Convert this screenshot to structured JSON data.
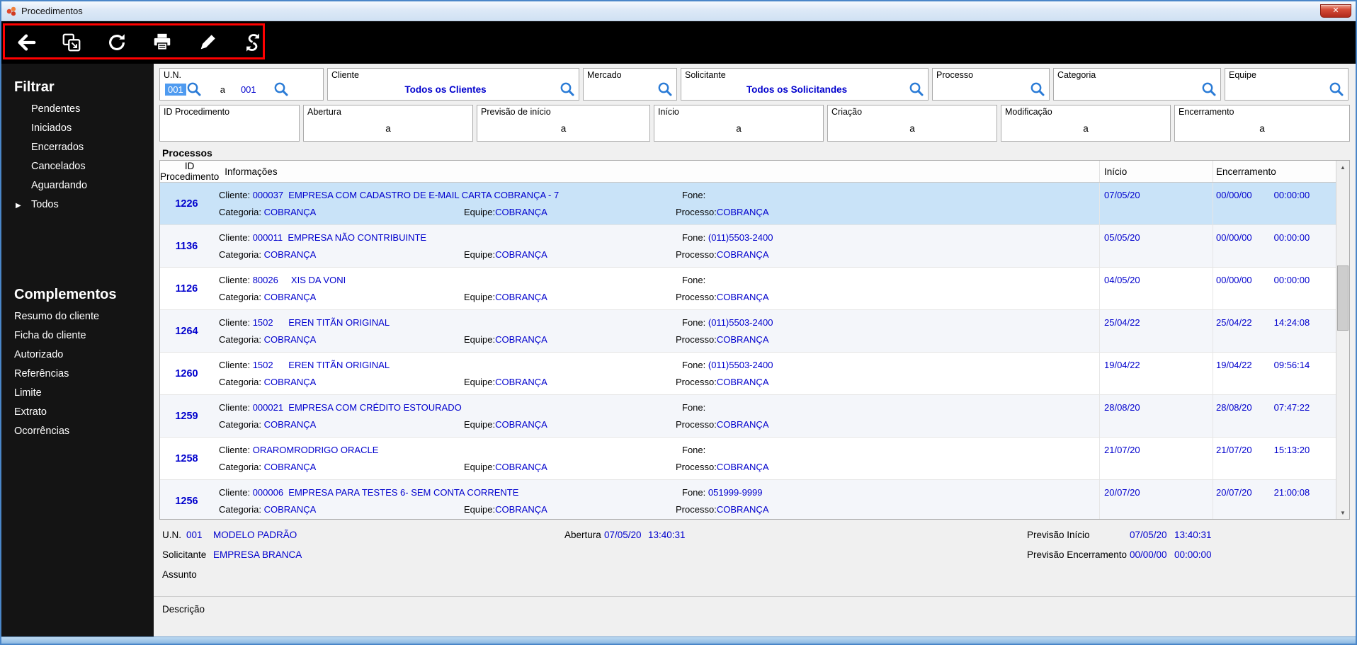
{
  "colors": {
    "accent_blue": "#0000CD",
    "selection_row": "#C9E3F8",
    "annotation_red": "#FF0000",
    "window_border": "#4A86C8",
    "toolbar_bg": "#000000",
    "sidebar_bg": "#141414"
  },
  "window": {
    "title": "Procedimentos",
    "close_glyph": "✕"
  },
  "scrollbar": {
    "up": "▲",
    "down": "▼"
  },
  "sidebar": {
    "filter_heading": "Filtrar",
    "filter_items": [
      "Pendentes",
      "Iniciados",
      "Encerrados",
      "Cancelados",
      "Aguardando",
      "Todos"
    ],
    "todos_marker": "▶",
    "complements_heading": "Complementos",
    "complement_items": [
      "Resumo do cliente",
      "Ficha do cliente",
      "Autorizado",
      "Referências",
      "Limite",
      "Extrato",
      "Ocorrências"
    ]
  },
  "filters": {
    "un_label": "U.N.",
    "un_from": "001",
    "range_sep": "a",
    "un_to": "001",
    "cliente_label": "Cliente",
    "cliente_value": "Todos os Clientes",
    "mercado_label": "Mercado",
    "solicitante_label": "Solicitante",
    "solicitante_value": "Todos os Solicitandes",
    "processo_label": "Processo",
    "categoria_label": "Categoria",
    "equipe_label": "Equipe",
    "id_proc_label": "ID Procedimento",
    "abertura_label": "Abertura",
    "previsao_inicio_label": "Previsão de início",
    "inicio_label": "Início",
    "criacao_label": "Criação",
    "modificacao_label": "Modificação",
    "encerramento_label": "Encerramento"
  },
  "table": {
    "section_label": "Processos",
    "headers": {
      "id": "ID Procedimento",
      "info": "Informações",
      "inicio": "Início",
      "encerramento": "Encerramento"
    },
    "labels": {
      "cliente": "Cliente:",
      "fone": "Fone:",
      "categoria": "Categoria:",
      "equipe": "Equipe:",
      "processo": "Processo:"
    },
    "rows": [
      {
        "id": "1226",
        "cliente": "000037  EMPRESA COM CADASTRO DE E-MAIL CARTA COBRANÇA - 7",
        "fone": "",
        "categoria": "COBRANÇA",
        "equipe": "COBRANÇA",
        "processo": "COBRANÇA",
        "inicio": "07/05/20",
        "encerramento_date": "00/00/00",
        "encerramento_time": "00:00:00",
        "selected": true
      },
      {
        "id": "1136",
        "cliente": "000011  EMPRESA NÃO CONTRIBUINTE",
        "fone": "(011)5503-2400",
        "categoria": "COBRANÇA",
        "equipe": "COBRANÇA",
        "processo": "COBRANÇA",
        "inicio": "05/05/20",
        "encerramento_date": "00/00/00",
        "encerramento_time": "00:00:00",
        "selected": false
      },
      {
        "id": "1126",
        "cliente": "80026     XIS DA VONI",
        "fone": "",
        "categoria": "COBRANÇA",
        "equipe": "COBRANÇA",
        "processo": "COBRANÇA",
        "inicio": "04/05/20",
        "encerramento_date": "00/00/00",
        "encerramento_time": "00:00:00",
        "selected": false
      },
      {
        "id": "1264",
        "cliente": "1502      EREN TITÃN ORIGINAL",
        "fone": "(011)5503-2400",
        "categoria": "COBRANÇA",
        "equipe": "COBRANÇA",
        "processo": "COBRANÇA",
        "inicio": "25/04/22",
        "encerramento_date": "25/04/22",
        "encerramento_time": "14:24:08",
        "selected": false
      },
      {
        "id": "1260",
        "cliente": "1502      EREN TITÃN ORIGINAL",
        "fone": "(011)5503-2400",
        "categoria": "COBRANÇA",
        "equipe": "COBRANÇA",
        "processo": "COBRANÇA",
        "inicio": "19/04/22",
        "encerramento_date": "19/04/22",
        "encerramento_time": "09:56:14",
        "selected": false
      },
      {
        "id": "1259",
        "cliente": "000021  EMPRESA COM CRÉDITO ESTOURADO",
        "fone": "",
        "categoria": "COBRANÇA",
        "equipe": "COBRANÇA",
        "processo": "COBRANÇA",
        "inicio": "28/08/20",
        "encerramento_date": "28/08/20",
        "encerramento_time": "07:47:22",
        "selected": false
      },
      {
        "id": "1258",
        "cliente": "ORAROMRODRIGO ORACLE",
        "fone": "",
        "categoria": "COBRANÇA",
        "equipe": "COBRANÇA",
        "processo": "COBRANÇA",
        "inicio": "21/07/20",
        "encerramento_date": "21/07/20",
        "encerramento_time": "15:13:20",
        "selected": false
      },
      {
        "id": "1256",
        "cliente": "000006  EMPRESA PARA TESTES 6- SEM CONTA CORRENTE",
        "fone": "051999-9999",
        "categoria": "COBRANÇA",
        "equipe": "COBRANÇA",
        "processo": "COBRANÇA",
        "inicio": "20/07/20",
        "encerramento_date": "20/07/20",
        "encerramento_time": "21:00:08",
        "selected": false
      }
    ]
  },
  "details": {
    "un_label": "U.N.",
    "un_value": "001",
    "un_name": "MODELO PADRÃO",
    "abertura_label": "Abertura",
    "abertura_date": "07/05/20",
    "abertura_time": "13:40:31",
    "previsao_inicio_label": "Previsão Início",
    "previsao_inicio_date": "07/05/20",
    "previsao_inicio_time": "13:40:31",
    "solicitante_label": "Solicitante",
    "solicitante_value": "EMPRESA BRANCA",
    "previsao_encerramento_label": "Previsão Encerramento",
    "previsao_encerramento_date": "00/00/00",
    "previsao_encerramento_time": "00:00:00",
    "assunto_label": "Assunto",
    "descricao_label": "Descrição"
  }
}
